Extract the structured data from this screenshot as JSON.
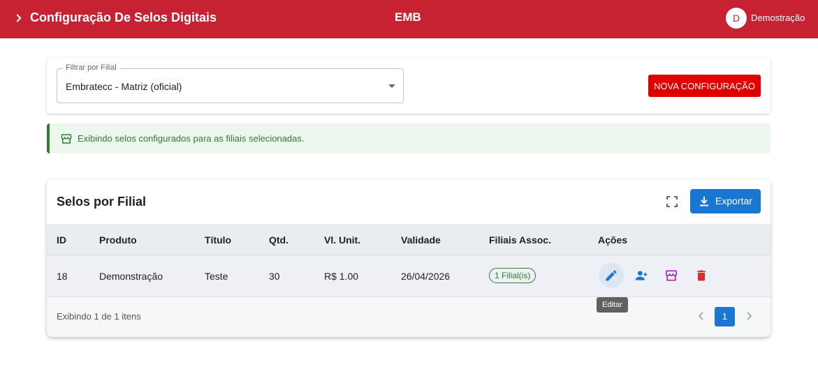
{
  "header": {
    "title": "Configuração De Selos Digitais",
    "center_text": "EMB",
    "avatar_initial": "D",
    "user_name": "Demostração"
  },
  "filter": {
    "label": "Filtrar por Filial",
    "value": "Embratecc - Matriz (oficial)",
    "new_button": "NOVA CONFIGURAÇÃO"
  },
  "alert": {
    "message": "Exibindo selos configurados para as filiais selecionadas."
  },
  "table": {
    "title": "Selos por Filial",
    "export_label": "Exportar",
    "columns": [
      "ID",
      "Produto",
      "Título",
      "Qtd.",
      "Vl. Unit.",
      "Validade",
      "Filiais Assoc.",
      "Ações"
    ],
    "rows": [
      {
        "id": "18",
        "produto": "Demonstração",
        "titulo": "Teste",
        "qtd": "30",
        "vl_unit": "R$ 1.00",
        "validade": "26/04/2026",
        "filiais": "1 Filial(is)"
      }
    ],
    "footer_count": "Exibindo 1 de 1 itens",
    "current_page": "1"
  },
  "tooltip": "Editar",
  "colors": {
    "brand": "#c62232",
    "primary": "#1976d2",
    "danger": "#e00000",
    "success": "#2e7d32",
    "purple": "#9c27b0",
    "delete": "#d32f2f"
  },
  "icons": [
    "chevron-right-icon",
    "store-icon",
    "fullscreen-icon",
    "download-icon",
    "edit-icon",
    "add-user-icon",
    "delete-icon",
    "chevron-left-icon"
  ]
}
